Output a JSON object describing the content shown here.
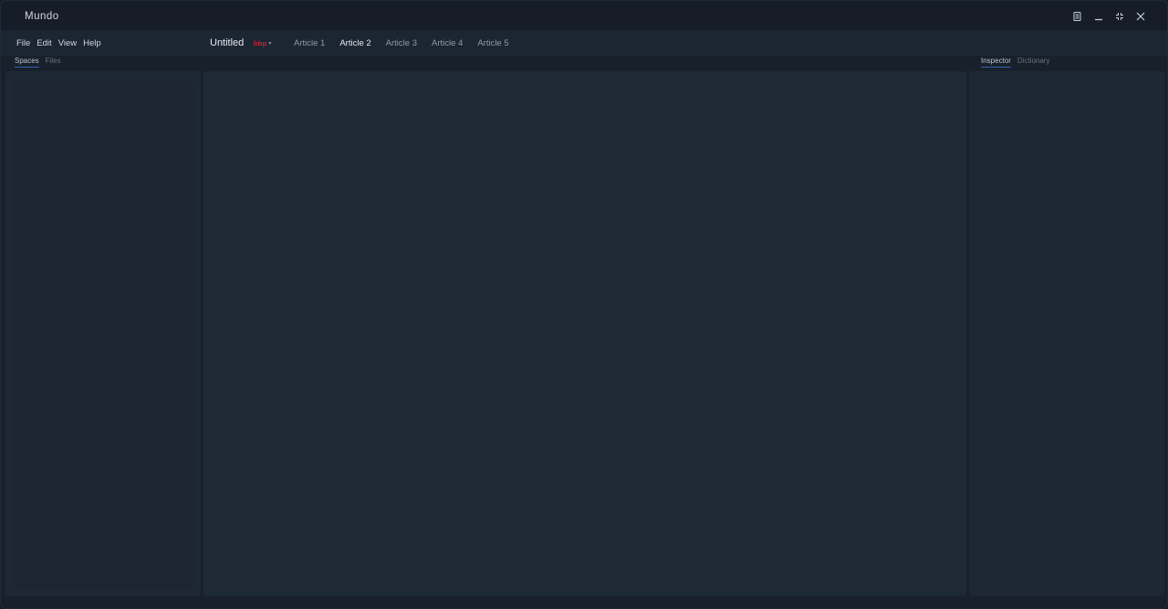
{
  "window": {
    "title": "Mundo"
  },
  "window_controls": [
    {
      "name": "document-icon"
    },
    {
      "name": "minimize-icon"
    },
    {
      "name": "fullscreen-icon"
    },
    {
      "name": "close-icon"
    }
  ],
  "menu": {
    "items": [
      "File",
      "Edit",
      "View",
      "Help"
    ]
  },
  "document": {
    "title": "Untitled",
    "badge": "bbp"
  },
  "tabs": [
    {
      "label": "Article 1",
      "active": false
    },
    {
      "label": "Article 2",
      "active": true
    },
    {
      "label": "Article 3",
      "active": false
    },
    {
      "label": "Article 4",
      "active": false
    },
    {
      "label": "Article 5",
      "active": false
    }
  ],
  "left_sidebar": {
    "tabs": [
      "Spaces",
      "Files"
    ],
    "active_tab": "Spaces"
  },
  "right_sidebar": {
    "tabs": [
      "Inspector",
      "Dictionary"
    ],
    "active_tab": "Inspector"
  },
  "colors": {
    "badge": "#d41f2e",
    "active_underline": "#3a5fb0",
    "background": "#1e2835"
  }
}
